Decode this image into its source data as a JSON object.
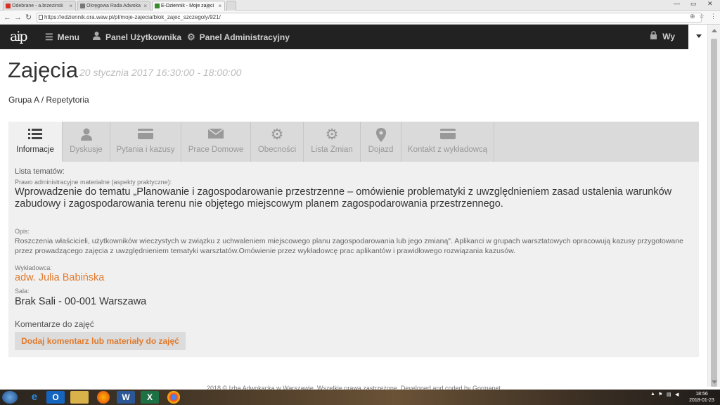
{
  "browser": {
    "tabs": [
      {
        "title": "Odebrane - a.brzezinsk",
        "favicon_color": "#d93025"
      },
      {
        "title": "Okręgowa Rada Adwoka",
        "favicon_color": "#777777"
      },
      {
        "title": "E-Dziennik - Moje zajęci",
        "favicon_color": "#3a8a2e"
      }
    ],
    "url": "https://edziennik.ora.waw.pl/pl/moje-zajecia/blok_zajec_szczegoly/921/"
  },
  "navbar": {
    "logo": "aip",
    "menu": "Menu",
    "user_panel": "Panel Użytkownika",
    "admin_panel": "Panel Administracyjny",
    "right_text": "Wy"
  },
  "page": {
    "title": "Zajęcia",
    "datetime": "20 stycznia 2017 16:30:00 - 18:00:00",
    "breadcrumb": "Grupa A / Repetytoria"
  },
  "tabs": [
    {
      "label": "Informacje",
      "icon": "list-icon",
      "active": true
    },
    {
      "label": "Dyskusje",
      "icon": "user-icon",
      "active": false
    },
    {
      "label": "Pytania i kazusy",
      "icon": "card-icon",
      "active": false
    },
    {
      "label": "Prace Domowe",
      "icon": "envelope-icon",
      "active": false
    },
    {
      "label": "Obecności",
      "icon": "gear-icon",
      "active": false
    },
    {
      "label": "Lista Zmian",
      "icon": "gear-icon",
      "active": false
    },
    {
      "label": "Dojazd",
      "icon": "map-pin-icon",
      "active": false
    },
    {
      "label": "Kontakt z wykładowcą",
      "icon": "card-icon",
      "active": false
    }
  ],
  "info": {
    "topics_label": "Lista tematów:",
    "subject": "Prawo administracyjne materialne (aspekty praktyczne):",
    "topic": "Wprowadzenie do tematu „Planowanie i zagospodarowanie przestrzenne – omówienie problematyki z uwzględnieniem zasad ustalenia warunków zabudowy i zagospodarowania terenu nie objętego miejscowym planem zagospodarowania przestrzennego.",
    "desc_label": "Opis:",
    "description": "Roszczenia właścicieli, użytkowników wieczystych w związku z uchwaleniem miejscowego planu zagospodarowania lub jego zmianą\". Aplikanci w grupach warsztatowych opracowują kazusy przygotowane przez prowadzącego zajęcia z uwzględnieniem tematyki warsztatów.Omówienie przez wykładowcę prac aplikantów i prawidłowego rozwiązania kazusów.",
    "lecturer_label": "Wykładowca:",
    "lecturer": "adw. Julia Babińska",
    "room_label": "Sala:",
    "room": "Brak Sali - 00-001 Warszawa",
    "comments_label": "Komentarze do zajęć",
    "comment_button": "Dodaj komentarz lub materiały do zajęć"
  },
  "footer": "2018 © Izba Adwokacka w Warszawie. Wszelkie prawa zastrzeżone. Developed and coded by Gormanet",
  "taskbar": {
    "time": "18:56",
    "date": "2018-01-23"
  },
  "colors": {
    "accent": "#e07b2e",
    "navbar": "#222222",
    "tab_bg": "#dadada",
    "panel_bg": "#f0f0f0"
  }
}
